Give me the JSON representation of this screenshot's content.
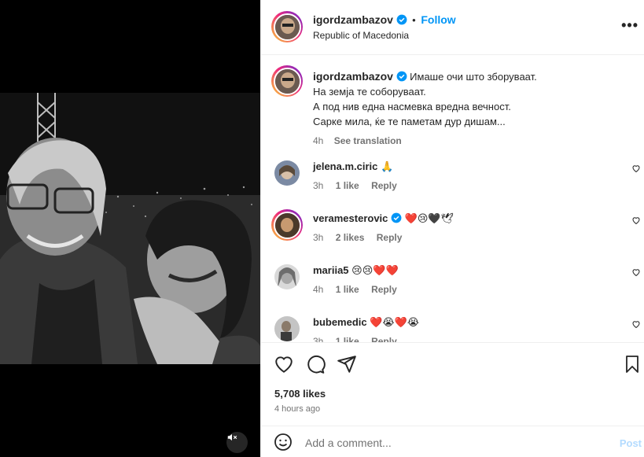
{
  "post": {
    "username": "igordzambazov",
    "follow_label": "Follow",
    "location": "Republic of Macedonia",
    "more_label": "•••",
    "caption_lines": [
      "Имаше очи што зборуваат.",
      "На земја те соборуваат.",
      "А под нив една насмевка вредна вечност.",
      "Сарке мила, ќе те паметам дур дишам..."
    ],
    "caption_time": "4h",
    "see_translation": "See translation",
    "likes": "5,708 likes",
    "posted_ago": "4 hours ago"
  },
  "comments": [
    {
      "user": "jelena.m.ciric",
      "text": "🙏",
      "time": "3h",
      "likes": "1 like",
      "reply": "Reply"
    },
    {
      "user": "veramesterovic",
      "text": "❤️😢🖤🕊",
      "time": "3h",
      "likes": "2 likes",
      "reply": "Reply",
      "verified": true
    },
    {
      "user": "mariia5",
      "text": "😢😢❤️❤️",
      "time": "4h",
      "likes": "1 like",
      "reply": "Reply"
    },
    {
      "user": "bubemedic",
      "text": "❤️😭❤️😭",
      "time": "3h",
      "likes": "1 like",
      "reply": "Reply"
    }
  ],
  "add_comment": {
    "placeholder": "Add a comment...",
    "post_label": "Post"
  },
  "colors": {
    "accent": "#0095f6",
    "verified": "#0095f6",
    "text": "#262626",
    "muted": "#737373"
  },
  "icons": [
    "heart-icon",
    "comment-icon",
    "share-icon",
    "bookmark-icon",
    "emoji-icon",
    "mute-icon",
    "verified-icon"
  ]
}
